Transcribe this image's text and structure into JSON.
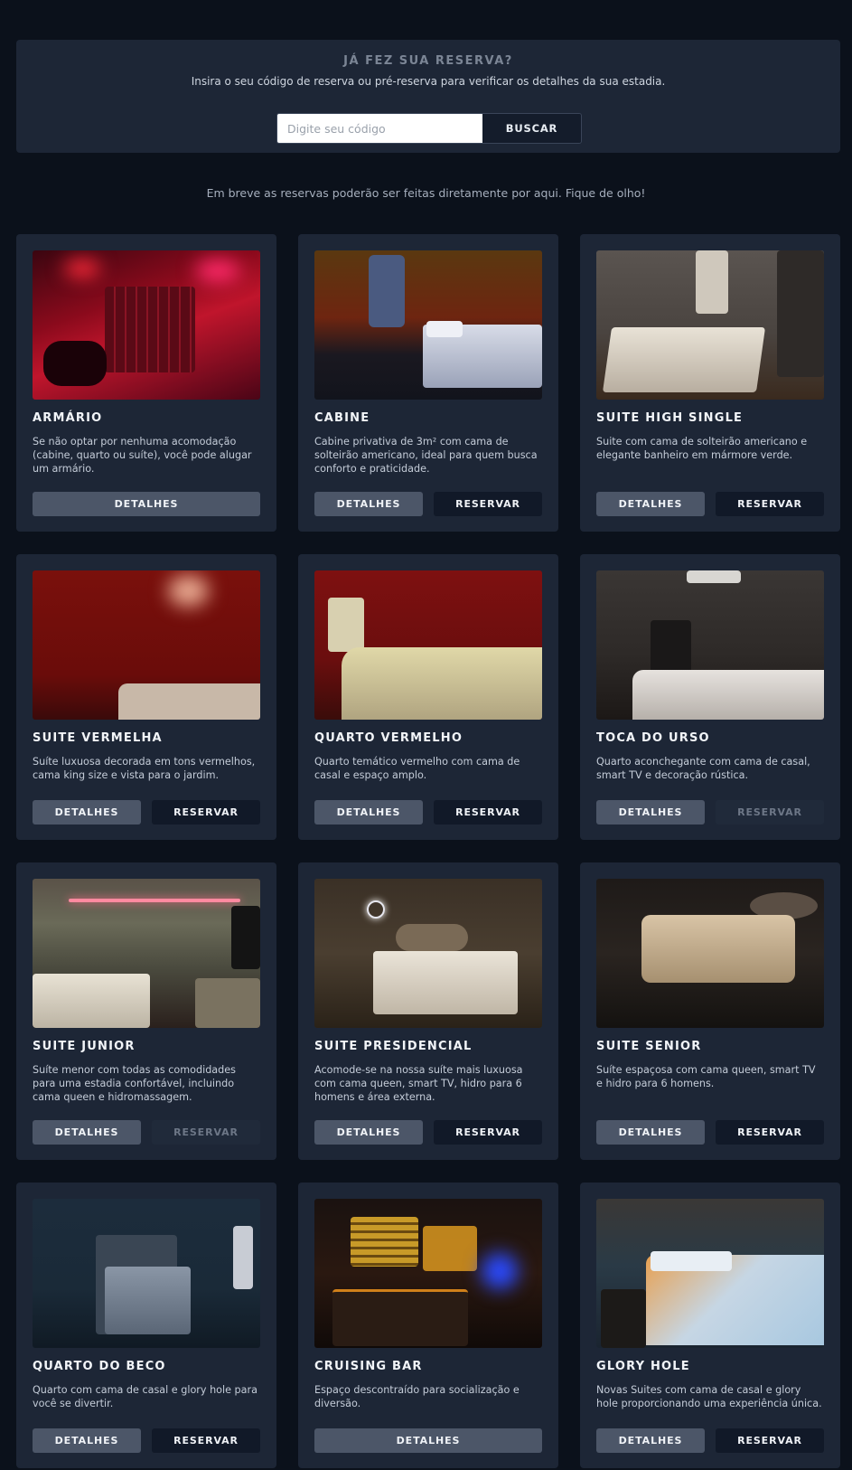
{
  "reserva": {
    "title": "JÁ FEZ SUA RESERVA?",
    "subtitle": "Insira o seu código de reserva ou pré-reserva para verificar os detalhes da sua estadia.",
    "placeholder": "Digite seu código",
    "button": "BUSCAR"
  },
  "notice": "Em breve as reservas poderão ser feitas diretamente por aqui. Fique de olho!",
  "cards": [
    {
      "title": "ARMÁRIO",
      "desc": "Se não optar por nenhuma acomodação (cabine, quarto ou suíte), você pode alugar um armário.",
      "details": "DETALHES",
      "reserve": null
    },
    {
      "title": "CABINE",
      "desc": "Cabine privativa de 3m² com cama de solteirão americano, ideal para quem busca conforto e praticidade.",
      "details": "DETALHES",
      "reserve": "RESERVAR"
    },
    {
      "title": "SUITE HIGH SINGLE",
      "desc": "Suite com cama de solteirão americano e elegante banheiro em mármore verde.",
      "details": "DETALHES",
      "reserve": "RESERVAR"
    },
    {
      "title": "SUITE VERMELHA",
      "desc": "Suíte luxuosa decorada em tons vermelhos, cama king size e vista para o jardim.",
      "details": "DETALHES",
      "reserve": "RESERVAR"
    },
    {
      "title": "QUARTO VERMELHO",
      "desc": "Quarto temático vermelho com cama de casal e espaço amplo.",
      "details": "DETALHES",
      "reserve": "RESERVAR"
    },
    {
      "title": "TOCA DO URSO",
      "desc": "Quarto aconchegante com cama de casal, smart TV e decoração rústica.",
      "details": "DETALHES",
      "reserve": "RESERVAR"
    },
    {
      "title": "SUITE JUNIOR",
      "desc": "Suíte menor com todas as comodidades para uma estadia confortável, incluindo cama queen e hidromassagem.",
      "details": "DETALHES",
      "reserve": "RESERVAR"
    },
    {
      "title": "SUITE PRESIDENCIAL",
      "desc": "Acomode-se na nossa suíte mais luxuosa com cama queen, smart TV, hidro para 6 homens e área externa.",
      "details": "DETALHES",
      "reserve": "RESERVAR"
    },
    {
      "title": "SUITE SENIOR",
      "desc": "Suíte espaçosa com cama queen, smart TV e hidro para 6 homens.",
      "details": "DETALHES",
      "reserve": "RESERVAR"
    },
    {
      "title": "QUARTO DO BECO",
      "desc": "Quarto com cama de casal e glory hole para você se divertir.",
      "details": "DETALHES",
      "reserve": "RESERVAR"
    },
    {
      "title": "CRUISING BAR",
      "desc": "Espaço descontraído para socialização e diversão.",
      "details": "DETALHES",
      "reserve": null
    },
    {
      "title": "GLORY HOLE",
      "desc": "Novas Suites com cama de casal e glory hole proporcionando uma experiência única.",
      "details": "DETALHES",
      "reserve": "RESERVAR"
    }
  ]
}
